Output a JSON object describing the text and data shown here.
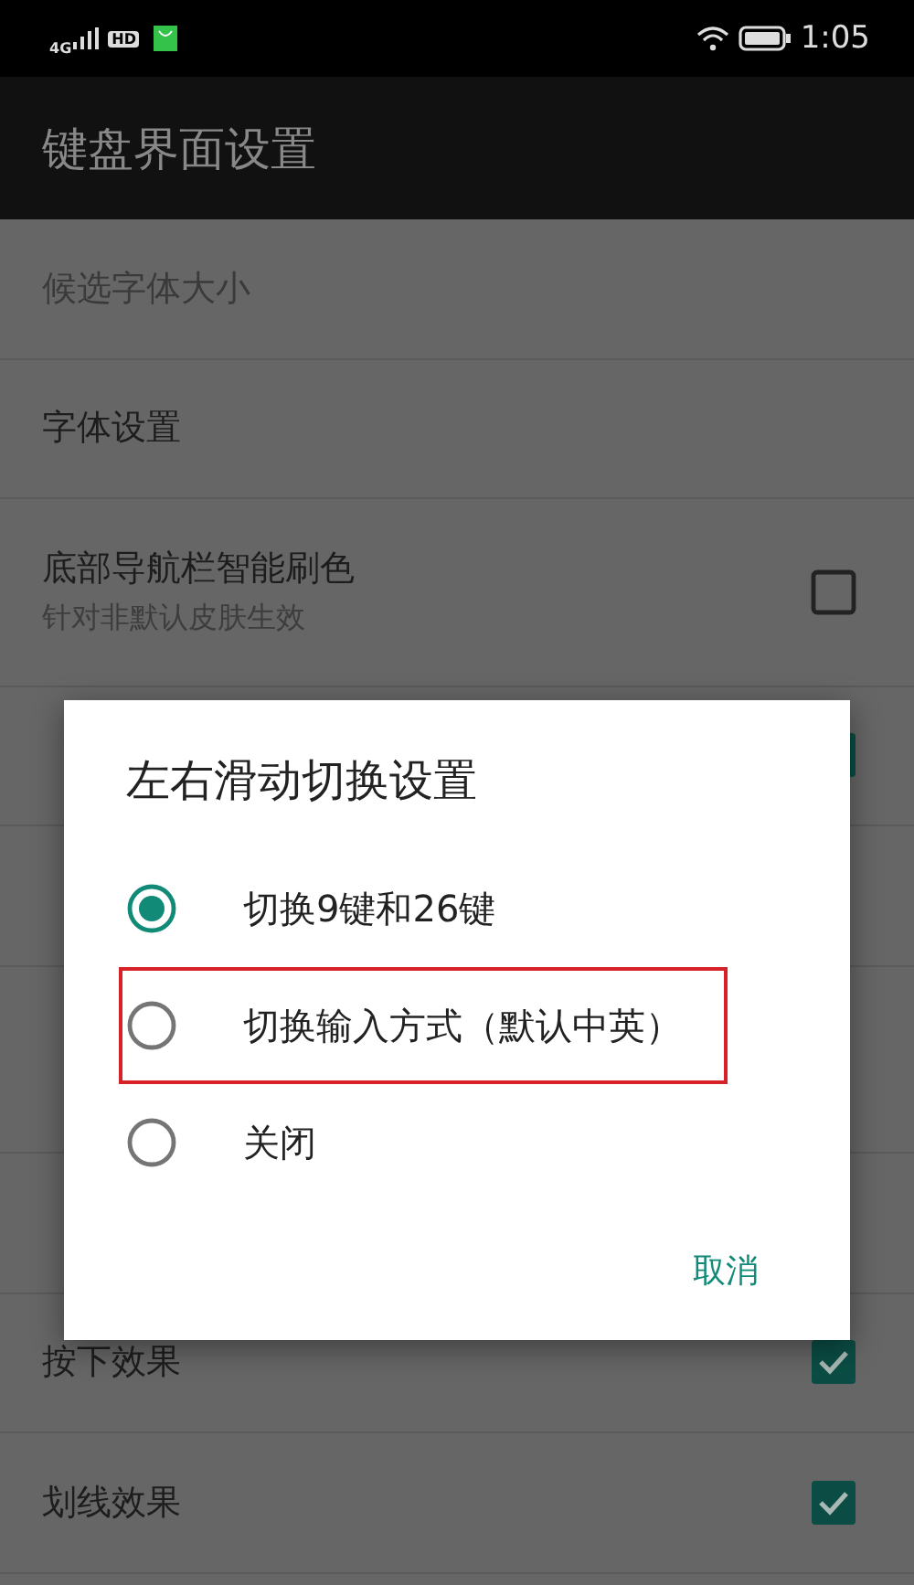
{
  "status_bar": {
    "network": "4G",
    "hd": "HD",
    "time": "1:05"
  },
  "app_bar": {
    "title": "键盘界面设置"
  },
  "settings": [
    {
      "kind": "plain",
      "title": "候选字体大小",
      "disabled": true
    },
    {
      "kind": "plain",
      "title": "字体设置",
      "disabled": false
    },
    {
      "kind": "checkbox",
      "title": "底部导航栏智能刷色",
      "subtitle": "针对非默认皮肤生效",
      "checked": false,
      "disabled": false
    },
    {
      "kind": "checkbox",
      "checked": true
    },
    {
      "kind": "plain"
    },
    {
      "kind": "two_line"
    },
    {
      "kind": "plain"
    },
    {
      "kind": "checkbox",
      "title": "按下效果",
      "checked": true,
      "disabled": false
    },
    {
      "kind": "checkbox",
      "title": "划线效果",
      "checked": true,
      "disabled": false
    }
  ],
  "dialog": {
    "title": "左右滑动切换设置",
    "options": [
      {
        "label": "切换9键和26键",
        "selected": true,
        "highlighted": false
      },
      {
        "label": "切换输入方式（默认中英）",
        "selected": false,
        "highlighted": true
      },
      {
        "label": "关闭",
        "selected": false,
        "highlighted": false
      }
    ],
    "button": "取消"
  }
}
